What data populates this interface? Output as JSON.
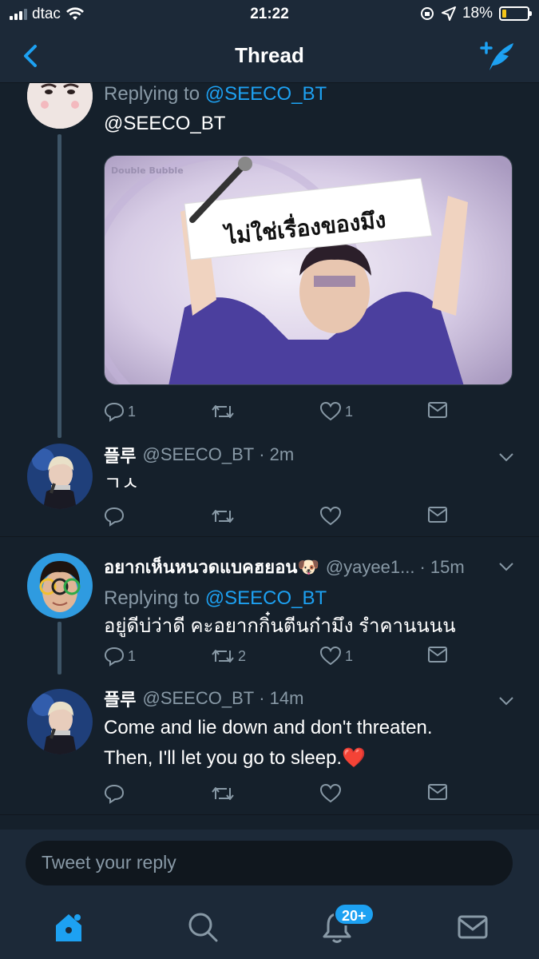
{
  "status_bar": {
    "carrier": "dtac",
    "time": "21:22",
    "battery_percent": "18%",
    "battery_level": 0.18
  },
  "nav": {
    "title": "Thread"
  },
  "tweets": [
    {
      "replying_label": "Replying to",
      "replying_to": "@SEECO_BT",
      "body": "@SEECO_BT",
      "media_caption": "ไม่ใช่เรื่องของมึง",
      "media_watermark": "Double Bubble",
      "reply_count": "1",
      "retweet_count": "",
      "like_count": "1"
    },
    {
      "display_name": "플루",
      "handle": "@SEECO_BT",
      "time": "· 2m",
      "body": "ㄱㅅ",
      "reply_count": "",
      "retweet_count": "",
      "like_count": ""
    },
    {
      "display_name": "อยากเห็นหนวดแบคฮยอน🐶",
      "handle": "@yayee1...",
      "time": "· 15m",
      "replying_label": "Replying to",
      "replying_to": "@SEECO_BT",
      "body": "อยู่ดีบ่ว่าดี คะอยากกิ๋นตีนก๋ามึง รำคานนนน",
      "reply_count": "1",
      "retweet_count": "2",
      "like_count": "1"
    },
    {
      "display_name": "플루",
      "handle": "@SEECO_BT",
      "time": "· 14m",
      "body_line1": "Come and lie down and don't threaten.",
      "body_line2": "Then, I'll let you go to sleep.❤️",
      "reply_count": "",
      "retweet_count": "",
      "like_count": ""
    }
  ],
  "composer": {
    "placeholder": "Tweet your reply"
  },
  "tabbar": {
    "notifications_badge": "20+"
  },
  "colors": {
    "background": "#15202b",
    "bar": "#1c2938",
    "accent": "#1da1f2",
    "muted": "#8899a6"
  }
}
